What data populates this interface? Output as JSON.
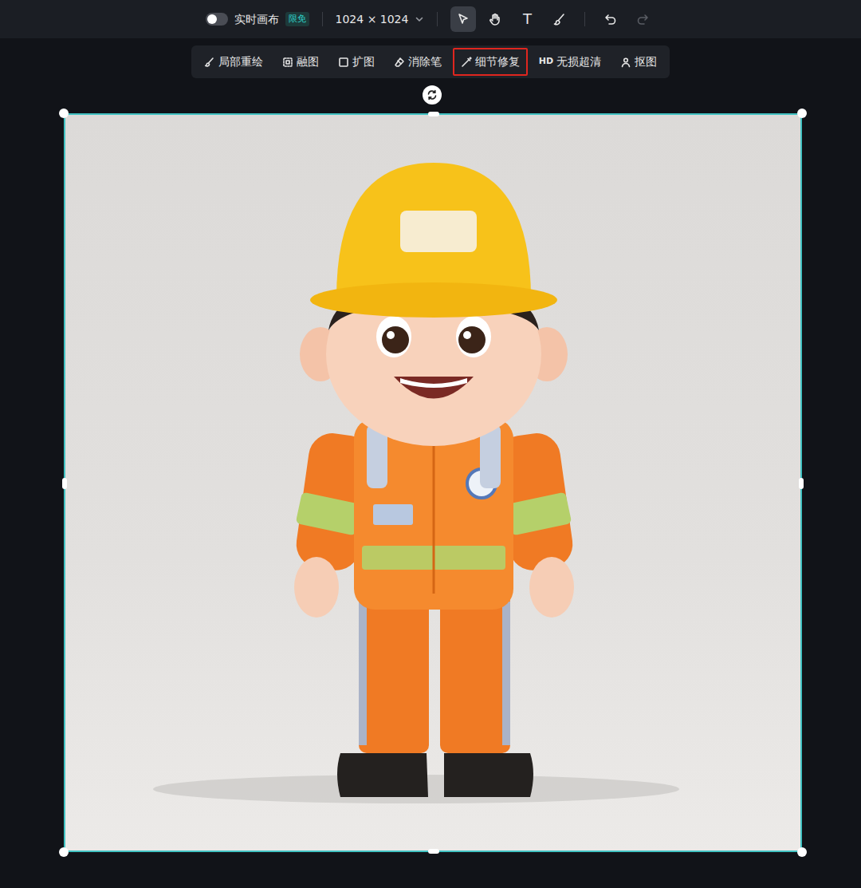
{
  "toolbar": {
    "realtime": {
      "label": "实时画布",
      "on": false,
      "badge": "限免"
    },
    "size": {
      "label": "1024 × 1024"
    },
    "tools": [
      {
        "kind": "select",
        "selected": true
      },
      {
        "kind": "hand",
        "selected": false
      },
      {
        "kind": "text",
        "glyph": "T",
        "selected": false
      },
      {
        "kind": "brush",
        "selected": false
      }
    ],
    "undo": {
      "disabled": false
    },
    "redo": {
      "disabled": true
    }
  },
  "edit_tools": [
    {
      "kind": "inpaint",
      "label": "局部重绘",
      "highlighted": false
    },
    {
      "kind": "blend",
      "label": "融图",
      "highlighted": false
    },
    {
      "kind": "expand",
      "label": "扩图",
      "highlighted": false
    },
    {
      "kind": "eraser",
      "label": "消除笔",
      "highlighted": false
    },
    {
      "kind": "repair",
      "label": "细节修复",
      "highlighted": true
    },
    {
      "kind": "upscale",
      "prefix": "HD",
      "label": "无损超清",
      "highlighted": false
    },
    {
      "kind": "cutout",
      "label": "抠图",
      "highlighted": false
    }
  ],
  "canvas": {
    "selected": true
  }
}
